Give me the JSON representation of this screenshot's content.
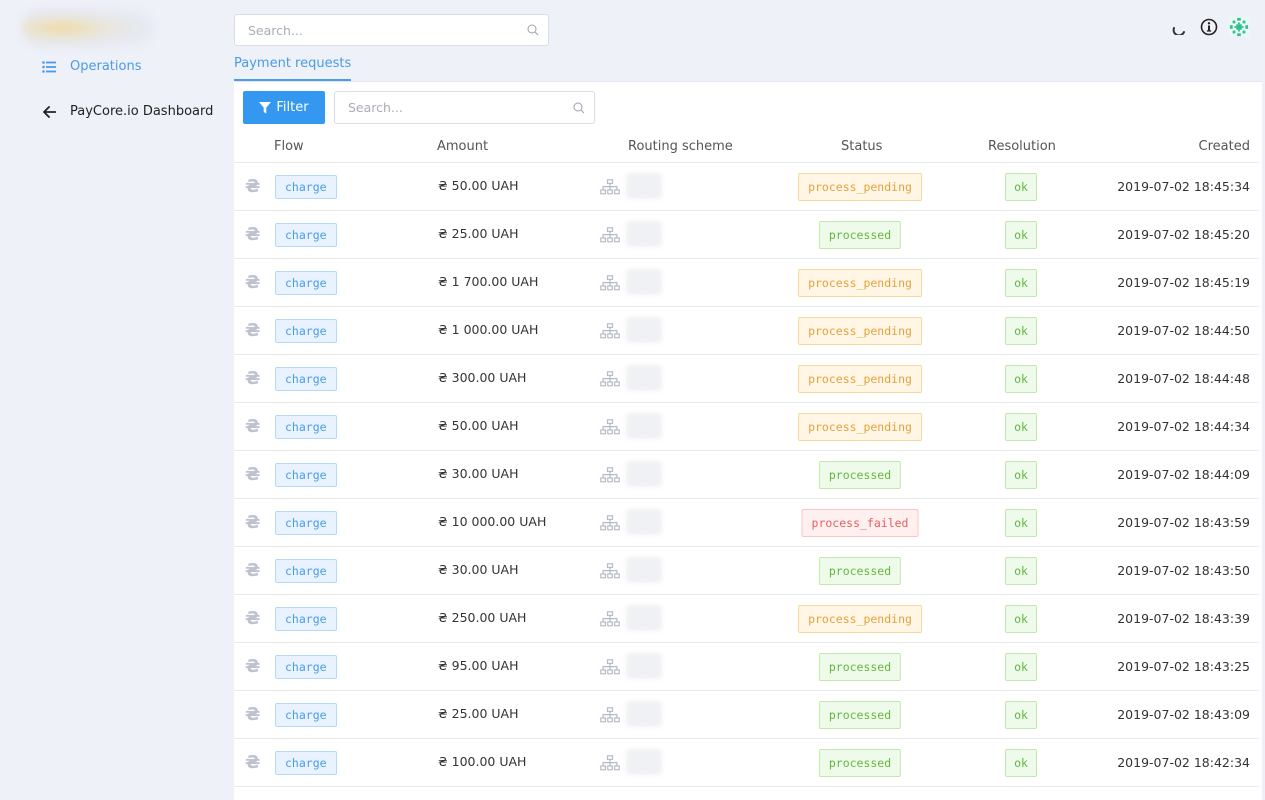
{
  "sidebar": {
    "items": [
      {
        "label": "Operations",
        "icon": "list-icon"
      },
      {
        "label": "PayCore.io Dashboard",
        "icon": "arrow-left-icon"
      }
    ]
  },
  "header": {
    "search_placeholder": "Search..."
  },
  "tabs": [
    {
      "label": "Payment requests"
    }
  ],
  "toolbar": {
    "filter_label": "Filter",
    "search_placeholder": "Search..."
  },
  "table": {
    "columns": [
      "Flow",
      "Amount",
      "Routing scheme",
      "Status",
      "Resolution",
      "Created"
    ],
    "rows": [
      {
        "currency_symbol": "₴",
        "flow": "charge",
        "amount": "₴ 50.00 UAH",
        "status": "process_pending",
        "resolution": "ok",
        "created": "2019-07-02 18:45:34"
      },
      {
        "currency_symbol": "₴",
        "flow": "charge",
        "amount": "₴ 25.00 UAH",
        "status": "processed",
        "resolution": "ok",
        "created": "2019-07-02 18:45:20"
      },
      {
        "currency_symbol": "₴",
        "flow": "charge",
        "amount": "₴ 1 700.00 UAH",
        "status": "process_pending",
        "resolution": "ok",
        "created": "2019-07-02 18:45:19"
      },
      {
        "currency_symbol": "₴",
        "flow": "charge",
        "amount": "₴ 1 000.00 UAH",
        "status": "process_pending",
        "resolution": "ok",
        "created": "2019-07-02 18:44:50"
      },
      {
        "currency_symbol": "₴",
        "flow": "charge",
        "amount": "₴ 300.00 UAH",
        "status": "process_pending",
        "resolution": "ok",
        "created": "2019-07-02 18:44:48"
      },
      {
        "currency_symbol": "₴",
        "flow": "charge",
        "amount": "₴ 50.00 UAH",
        "status": "process_pending",
        "resolution": "ok",
        "created": "2019-07-02 18:44:34"
      },
      {
        "currency_symbol": "₴",
        "flow": "charge",
        "amount": "₴ 30.00 UAH",
        "status": "processed",
        "resolution": "ok",
        "created": "2019-07-02 18:44:09"
      },
      {
        "currency_symbol": "₴",
        "flow": "charge",
        "amount": "₴ 10 000.00 UAH",
        "status": "process_failed",
        "resolution": "ok",
        "created": "2019-07-02 18:43:59"
      },
      {
        "currency_symbol": "₴",
        "flow": "charge",
        "amount": "₴ 30.00 UAH",
        "status": "processed",
        "resolution": "ok",
        "created": "2019-07-02 18:43:50"
      },
      {
        "currency_symbol": "₴",
        "flow": "charge",
        "amount": "₴ 250.00 UAH",
        "status": "process_pending",
        "resolution": "ok",
        "created": "2019-07-02 18:43:39"
      },
      {
        "currency_symbol": "₴",
        "flow": "charge",
        "amount": "₴ 95.00 UAH",
        "status": "processed",
        "resolution": "ok",
        "created": "2019-07-02 18:43:25"
      },
      {
        "currency_symbol": "₴",
        "flow": "charge",
        "amount": "₴ 25.00 UAH",
        "status": "processed",
        "resolution": "ok",
        "created": "2019-07-02 18:43:09"
      },
      {
        "currency_symbol": "₴",
        "flow": "charge",
        "amount": "₴ 100.00 UAH",
        "status": "processed",
        "resolution": "ok",
        "created": "2019-07-02 18:42:34"
      }
    ]
  },
  "colors": {
    "accent": "#3498f0",
    "pending": "#e5a23a",
    "processed": "#62b83c",
    "failed": "#e56060"
  }
}
